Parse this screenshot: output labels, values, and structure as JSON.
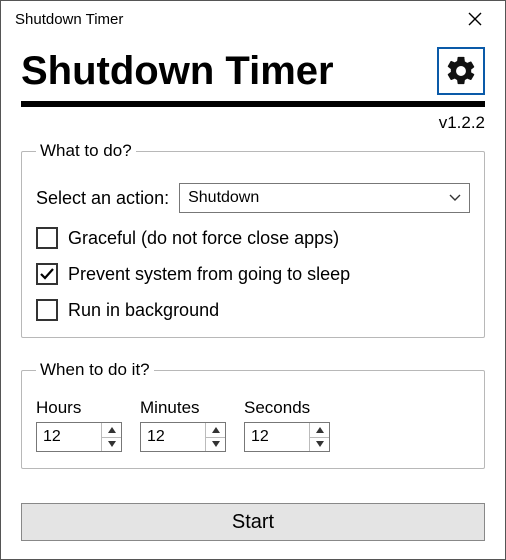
{
  "window": {
    "title": "Shutdown Timer"
  },
  "header": {
    "appTitle": "Shutdown Timer",
    "version": "v1.2.2"
  },
  "whatToDo": {
    "legend": "What to do?",
    "selectLabel": "Select an action:",
    "selectedAction": "Shutdown",
    "gracefulLabel": "Graceful (do not force close apps)",
    "gracefulChecked": false,
    "preventSleepLabel": "Prevent system from going to sleep",
    "preventSleepChecked": true,
    "backgroundLabel": "Run in background",
    "backgroundChecked": false
  },
  "whenToDo": {
    "legend": "When to do it?",
    "hoursLabel": "Hours",
    "minutesLabel": "Minutes",
    "secondsLabel": "Seconds",
    "hours": "12",
    "minutes": "12",
    "seconds": "12"
  },
  "startLabel": "Start"
}
